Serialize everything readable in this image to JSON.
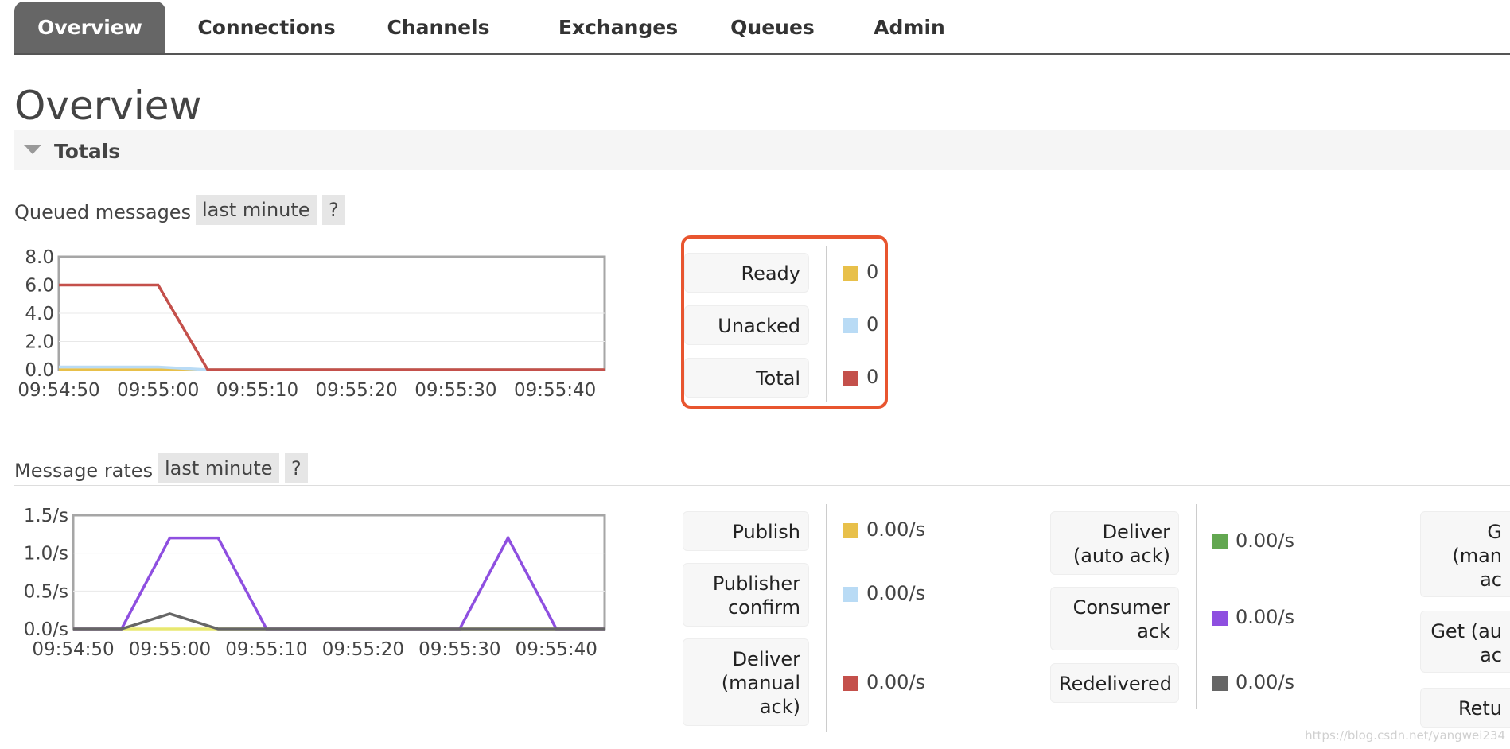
{
  "nav": {
    "tabs": [
      {
        "label": "Overview",
        "active": true
      },
      {
        "label": "Connections"
      },
      {
        "label": "Channels"
      },
      {
        "label": "Exchanges"
      },
      {
        "label": "Queues"
      },
      {
        "label": "Admin"
      }
    ]
  },
  "page": {
    "title": "Overview",
    "section": "Totals"
  },
  "queued": {
    "heading": "Queued messages",
    "range": "last minute",
    "help": "?",
    "legend": [
      {
        "label": "Ready",
        "value": "0",
        "color": "#e8c04a"
      },
      {
        "label": "Unacked",
        "value": "0",
        "color": "#b9dbf5"
      },
      {
        "label": "Total",
        "value": "0",
        "color": "#c4504b"
      }
    ]
  },
  "rates": {
    "heading": "Message rates",
    "range": "last minute",
    "help": "?",
    "col1": [
      {
        "label": [
          "Publish"
        ],
        "value": "0.00/s",
        "color": "#e8c04a"
      },
      {
        "label": [
          "Publisher",
          "confirm"
        ],
        "value": "0.00/s",
        "color": "#b9dbf5"
      },
      {
        "label": [
          "Deliver",
          "(manual",
          "ack)"
        ],
        "value": "0.00/s",
        "color": "#c4504b"
      }
    ],
    "col2": [
      {
        "label": [
          "Deliver",
          "(auto ack)"
        ],
        "value": "0.00/s",
        "color": "#62a750"
      },
      {
        "label": [
          "Consumer",
          "ack"
        ],
        "value": "0.00/s",
        "color": "#8e4fe0"
      },
      {
        "label": [
          "Redelivered"
        ],
        "value": "0.00/s",
        "color": "#666666"
      }
    ],
    "col3": [
      {
        "label": [
          "G",
          "(man",
          "ac"
        ]
      },
      {
        "label": [
          "Get (au",
          "ac"
        ]
      },
      {
        "label": [
          "Retu"
        ]
      }
    ]
  },
  "chart_data": [
    {
      "type": "line",
      "x": [
        "09:54:50",
        "09:54:55",
        "09:55:00",
        "09:55:05",
        "09:55:10",
        "09:55:15",
        "09:55:20",
        "09:55:25",
        "09:55:30",
        "09:55:35",
        "09:55:40",
        "09:55:45"
      ],
      "xticks": [
        "09:54:50",
        "09:55:00",
        "09:55:10",
        "09:55:20",
        "09:55:30",
        "09:55:40"
      ],
      "yticks": [
        "0.0",
        "2.0",
        "4.0",
        "6.0",
        "8.0"
      ],
      "ylim": [
        0,
        8
      ],
      "series": [
        {
          "name": "Ready",
          "color": "#e8c04a",
          "values": [
            0,
            0,
            0,
            0,
            0,
            0,
            0,
            0,
            0,
            0,
            0,
            0
          ]
        },
        {
          "name": "Unacked",
          "color": "#b9dbf5",
          "values": [
            0.2,
            0.2,
            0.2,
            0,
            0,
            0,
            0,
            0,
            0,
            0,
            0,
            0
          ]
        },
        {
          "name": "Total",
          "color": "#c4504b",
          "values": [
            6,
            6,
            6,
            0,
            0,
            0,
            0,
            0,
            0,
            0,
            0,
            0
          ]
        }
      ]
    },
    {
      "type": "line",
      "x": [
        "09:54:50",
        "09:54:55",
        "09:55:00",
        "09:55:05",
        "09:55:10",
        "09:55:15",
        "09:55:20",
        "09:55:25",
        "09:55:30",
        "09:55:35",
        "09:55:40",
        "09:55:45"
      ],
      "xticks": [
        "09:54:50",
        "09:55:00",
        "09:55:10",
        "09:55:20",
        "09:55:30",
        "09:55:40"
      ],
      "yticks": [
        "0.0/s",
        "0.5/s",
        "1.0/s",
        "1.5/s"
      ],
      "ylim": [
        0,
        1.5
      ],
      "series": [
        {
          "name": "Publish",
          "color": "#e8e870",
          "values": [
            0,
            0,
            0,
            0,
            0,
            0,
            0,
            0,
            0,
            0,
            0,
            0
          ]
        },
        {
          "name": "Consumer ack",
          "color": "#8e4fe0",
          "values": [
            0,
            0,
            1.2,
            1.2,
            0,
            0,
            0,
            0,
            0,
            1.2,
            0,
            0
          ]
        },
        {
          "name": "Redelivered",
          "color": "#666666",
          "values": [
            0,
            0,
            0.2,
            0,
            0,
            0,
            0,
            0,
            0,
            0,
            0,
            0
          ]
        }
      ]
    }
  ]
}
